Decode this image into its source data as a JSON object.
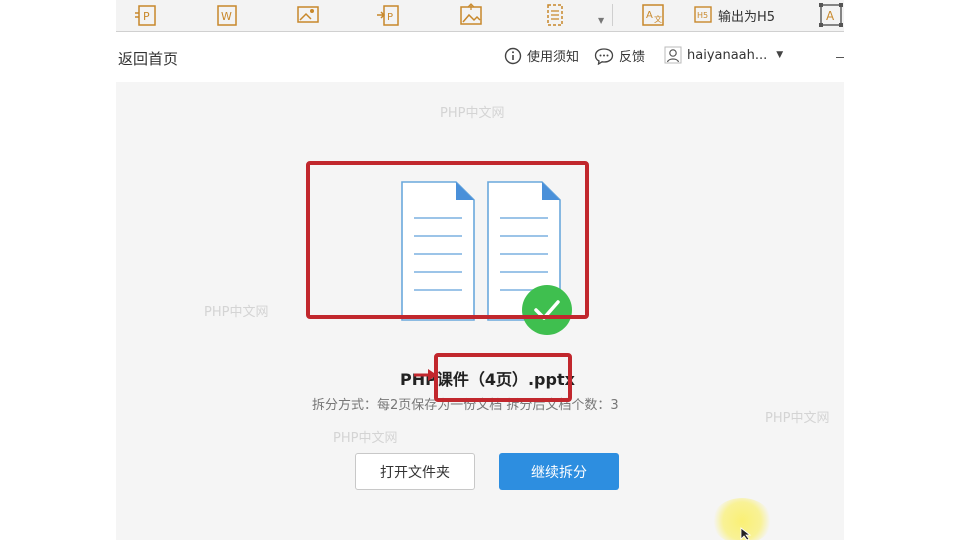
{
  "toolbar": {
    "buttons": [
      {
        "name": "ppt-to-pdf-icon"
      },
      {
        "name": "word-icon"
      },
      {
        "name": "image-convert-icon"
      },
      {
        "name": "pdf-convert-icon"
      },
      {
        "name": "image-icon"
      },
      {
        "name": "page-icon"
      },
      {
        "name": "translate-icon"
      },
      {
        "name": "text-box-icon"
      }
    ],
    "h5_label": "输出为H5"
  },
  "header": {
    "back_label": "返回首页",
    "notice_label": "使用须知",
    "feedback_label": "反馈",
    "user_name": "haiyanaah..."
  },
  "watermark_text": "PHP中文网",
  "result": {
    "file_name": "PHP课件（4页）.pptx",
    "split_info": "拆分方式：每2页保存为一份文档    拆分后文档个数：3"
  },
  "actions": {
    "open_folder_label": "打开文件夹",
    "continue_label": "继续拆分"
  },
  "colors": {
    "accent": "#2d8ee0",
    "success": "#3fbf4f",
    "highlight": "#c1272d",
    "doc_line": "#9cc4e8"
  }
}
